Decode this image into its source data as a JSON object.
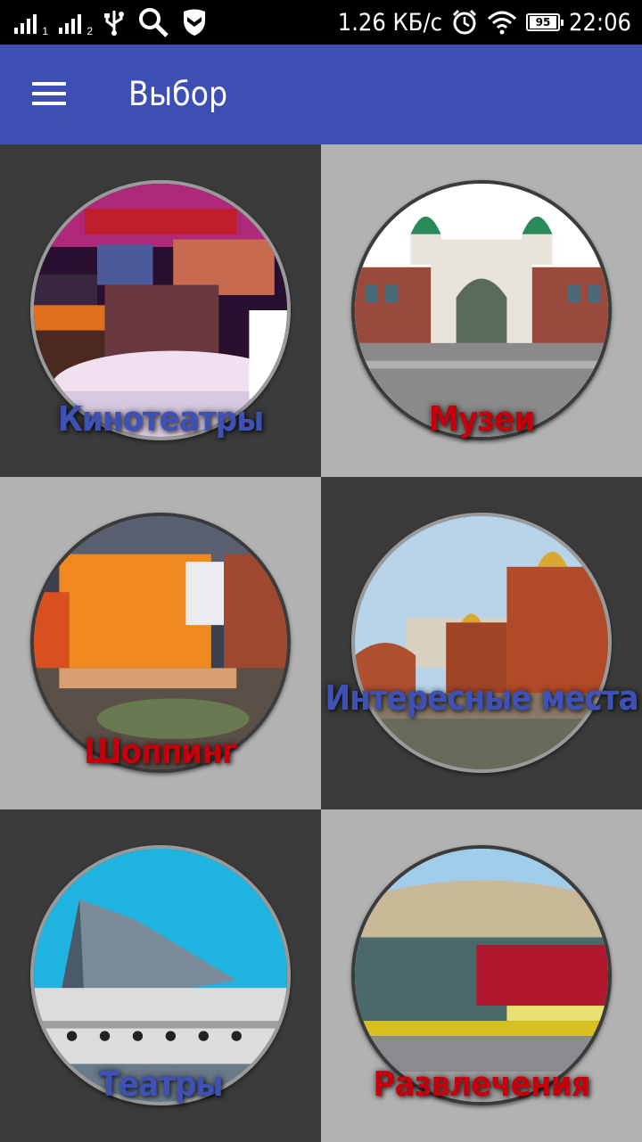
{
  "status_bar": {
    "sim1_sub": "1",
    "sim2_sub": "2",
    "net_speed": "1.26 КБ/с",
    "battery": "95",
    "time": "22:06",
    "icons": [
      "signal-icon",
      "signal-icon",
      "usb-icon",
      "search-icon",
      "shield-icon",
      "alarm-icon",
      "wifi-icon",
      "battery-icon"
    ]
  },
  "app_bar": {
    "menu_icon": "hamburger-icon",
    "title": "Выбор"
  },
  "categories": [
    {
      "label": "Кинотеатры",
      "color": "#3f51b5",
      "image": "cinema-lobby"
    },
    {
      "label": "Музеи",
      "color": "#c4000d",
      "image": "museum-building"
    },
    {
      "label": "Шоппинг",
      "color": "#c4000d",
      "image": "shopping-mall"
    },
    {
      "label": "Интересные места",
      "color": "#3f51b5",
      "image": "cathedral"
    },
    {
      "label": "Театры",
      "color": "#3f51b5",
      "image": "opera-theatre"
    },
    {
      "label": "Развлечения",
      "color": "#c4000d",
      "image": "circus"
    }
  ]
}
